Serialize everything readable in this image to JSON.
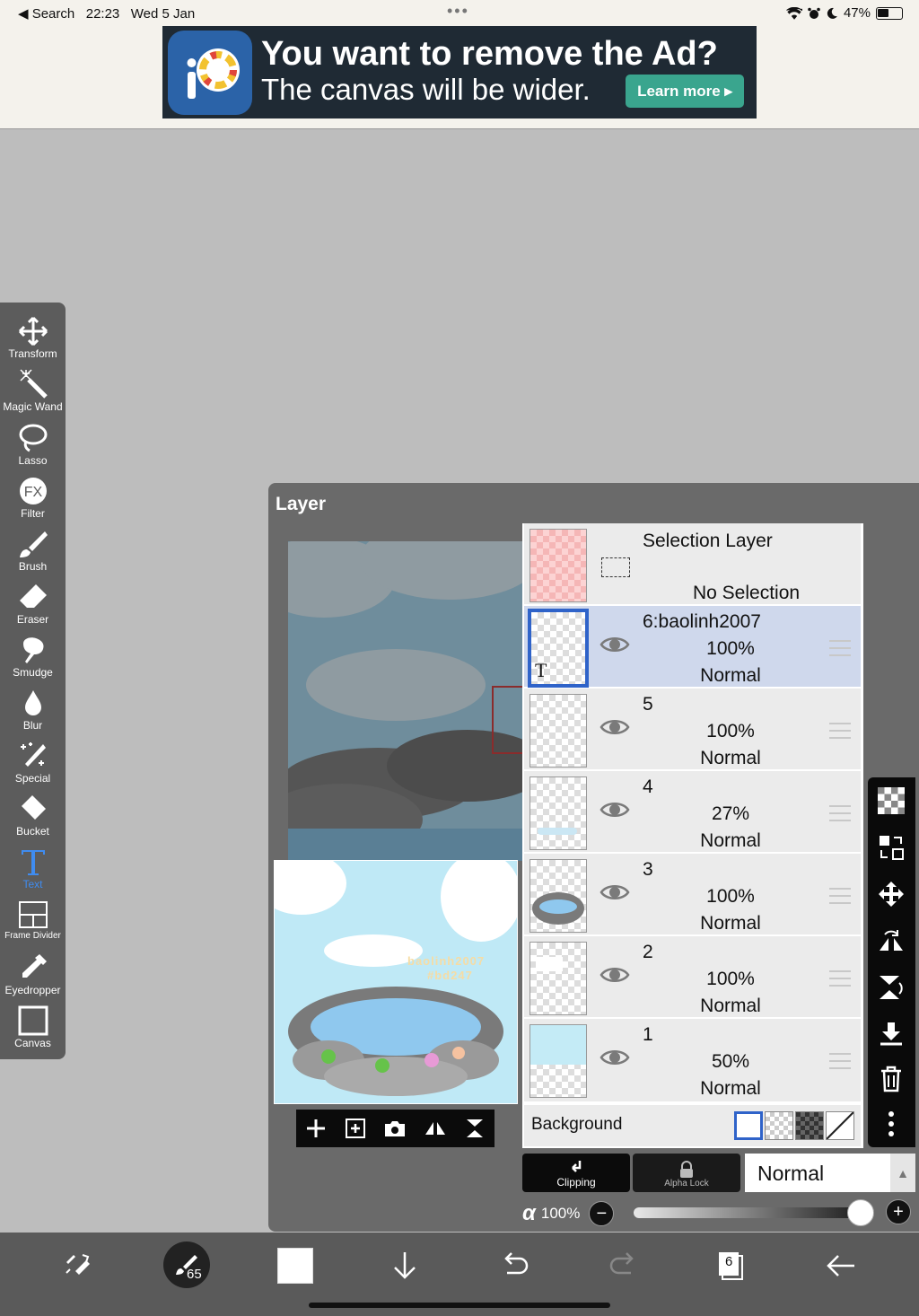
{
  "status": {
    "left": "◀ Search   22:23   Wed 5 Jan",
    "battery": "47%"
  },
  "ad": {
    "headline": "You want to remove the Ad?",
    "sub": "The canvas will be wider.",
    "button": "Learn more ▸",
    "logo_letter": "iP"
  },
  "tools": [
    {
      "label": "Transform",
      "icon": "transform-icon"
    },
    {
      "label": "Magic Wand",
      "icon": "magic-wand-icon"
    },
    {
      "label": "Lasso",
      "icon": "lasso-icon"
    },
    {
      "label": "Filter",
      "icon": "filter-icon"
    },
    {
      "label": "Brush",
      "icon": "brush-icon"
    },
    {
      "label": "Eraser",
      "icon": "eraser-icon"
    },
    {
      "label": "Smudge",
      "icon": "smudge-icon"
    },
    {
      "label": "Blur",
      "icon": "blur-icon"
    },
    {
      "label": "Special",
      "icon": "special-icon"
    },
    {
      "label": "Bucket",
      "icon": "bucket-icon"
    },
    {
      "label": "Text",
      "icon": "text-icon"
    },
    {
      "label": "Frame Divider",
      "icon": "frame-divider-icon"
    },
    {
      "label": "Eyedropper",
      "icon": "eyedropper-icon"
    },
    {
      "label": "Canvas",
      "icon": "canvas-icon"
    }
  ],
  "panel": {
    "title": "Layer"
  },
  "canvas_text": {
    "line1": "baolinh2007",
    "line2": "#bd247"
  },
  "selection_layer": {
    "name": "Selection Layer",
    "state": "No Selection"
  },
  "layers": [
    {
      "name": "6:baolinh2007",
      "opacity": "100%",
      "blend": "Normal",
      "selected": true,
      "thumb_mark": "T"
    },
    {
      "name": "5",
      "opacity": "100%",
      "blend": "Normal"
    },
    {
      "name": "4",
      "opacity": "27%",
      "blend": "Normal"
    },
    {
      "name": "3",
      "opacity": "100%",
      "blend": "Normal"
    },
    {
      "name": "2",
      "opacity": "100%",
      "blend": "Normal"
    },
    {
      "name": "1",
      "opacity": "50%",
      "blend": "Normal"
    }
  ],
  "background": {
    "label": "Background"
  },
  "bottom_panel": {
    "clipping": "Clipping",
    "alpha_lock": "Alpha Lock",
    "blend_mode": "Normal",
    "alpha_symbol": "α",
    "alpha_value": "100%",
    "alpha_level": 1.0
  },
  "bottom_bar": {
    "brush_size": "65",
    "layer_count": "6"
  },
  "colors": {
    "accent": "#3f8cf0",
    "selected_row": "#cfd8ec",
    "ad_button": "#3aa58e"
  }
}
